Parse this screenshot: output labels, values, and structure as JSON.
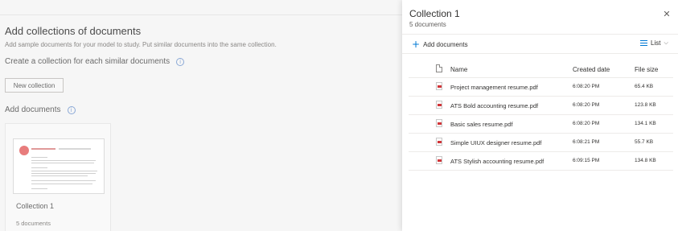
{
  "page": {
    "title": "Add collections of documents",
    "description": "Add sample documents for your model to study. Put similar documents into the same collection.",
    "create_heading": "Create a collection for each similar documents",
    "new_collection_button": "New collection",
    "add_documents_heading": "Add documents"
  },
  "card": {
    "title": "Collection 1",
    "count": "5 documents"
  },
  "panel": {
    "title": "Collection 1",
    "subtitle": "5 documents",
    "add_documents_label": "Add documents",
    "view_label": "List",
    "columns": {
      "name": "Name",
      "created": "Created date",
      "size": "File size"
    },
    "rows": [
      {
        "name": "Project management resume.pdf",
        "created": "6:08:20 PM",
        "size": "65.4 KB"
      },
      {
        "name": "ATS Bold accounting resume.pdf",
        "created": "6:08:20 PM",
        "size": "123.8 KB"
      },
      {
        "name": "Basic sales resume.pdf",
        "created": "6:08:20 PM",
        "size": "134.1 KB"
      },
      {
        "name": "Simple UIUX designer resume.pdf",
        "created": "6:08:21 PM",
        "size": "55.7 KB"
      },
      {
        "name": "ATS Stylish accounting resume.pdf",
        "created": "6:09:15 PM",
        "size": "134.8 KB"
      }
    ]
  },
  "icons": {
    "info": "info-icon",
    "close": "close-icon",
    "add": "plus-icon",
    "list": "list-icon",
    "file": "pdf-file-icon"
  },
  "colors": {
    "accent": "#0078d4",
    "pdf": "#d13438"
  }
}
